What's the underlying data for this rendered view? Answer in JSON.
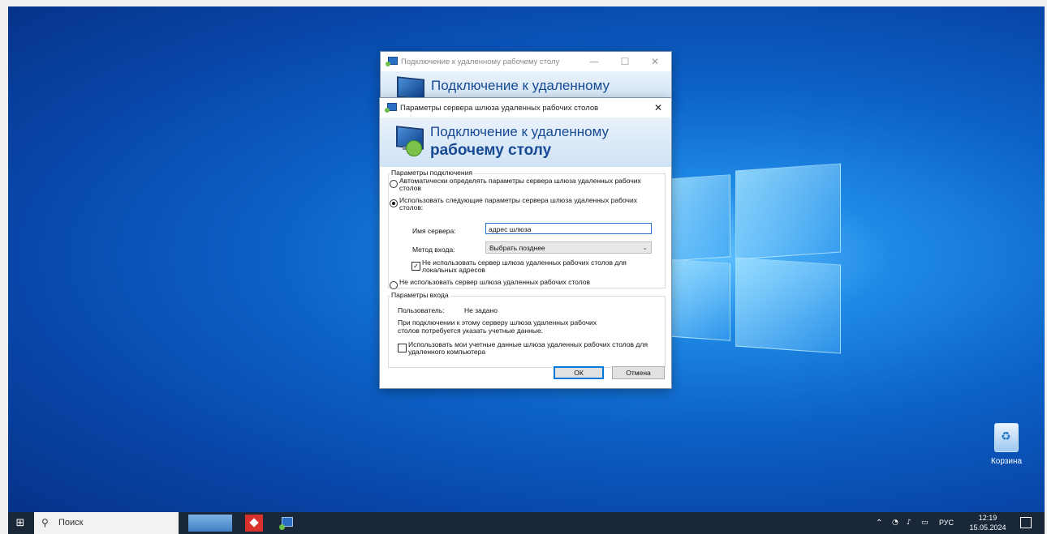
{
  "back_dialog": {
    "title": "Подключение к удаленному рабочему столу",
    "banner_text": "Подключение к удаленному",
    "minimize_glyph": "—",
    "maximize_glyph": "☐",
    "close_glyph": "✕"
  },
  "gateway_dialog": {
    "title": "Параметры сервера шлюза удаленных рабочих столов",
    "close_glyph": "✕",
    "banner": {
      "line1": "Подключение к удаленному",
      "line2": "рабочему столу"
    },
    "connection_group": {
      "title": "Параметры подключения",
      "options": [
        {
          "label": "Автоматически определять параметры сервера шлюза удаленных рабочих столов",
          "selected": false
        },
        {
          "label": "Использовать следующие параметры сервера шлюза удаленных рабочих столов:",
          "selected": true
        },
        {
          "label": "Не использовать сервер шлюза удаленных рабочих столов",
          "selected": false
        }
      ],
      "server_name_label": "Имя сервера:",
      "server_name_value": "адрес шлюза",
      "logon_method_label": "Метод входа:",
      "logon_method_value": "Выбрать позднее",
      "bypass_local_label": "Не использовать сервер шлюза удаленных рабочих столов для локальных адресов",
      "bypass_local_checked": true
    },
    "logon_group": {
      "title": "Параметры входа",
      "user_label": "Пользователь:",
      "user_value": "Не задано",
      "info_text": "При подключении к этому серверу шлюза удаленных рабочих столов потребуется указать учетные данные.",
      "use_creds_label": "Использовать мои учетные данные шлюза удаленных рабочих столов для удаленного компьютера",
      "use_creds_checked": false
    },
    "ok_label": "ОК",
    "cancel_label": "Отмена"
  },
  "desktop": {
    "recycle_bin_label": "Корзина"
  },
  "taskbar": {
    "search_placeholder": "Поиск",
    "language": "РУС",
    "time": "12:19",
    "date": "15.05.2024"
  },
  "icons": [
    "windows-start-icon",
    "search-icon",
    "file-explorer-icon",
    "anydesk-icon",
    "remote-desktop-icon",
    "recycle-bin-icon",
    "chevron-up-icon",
    "network-icon",
    "volume-icon",
    "battery-icon",
    "notifications-icon"
  ]
}
